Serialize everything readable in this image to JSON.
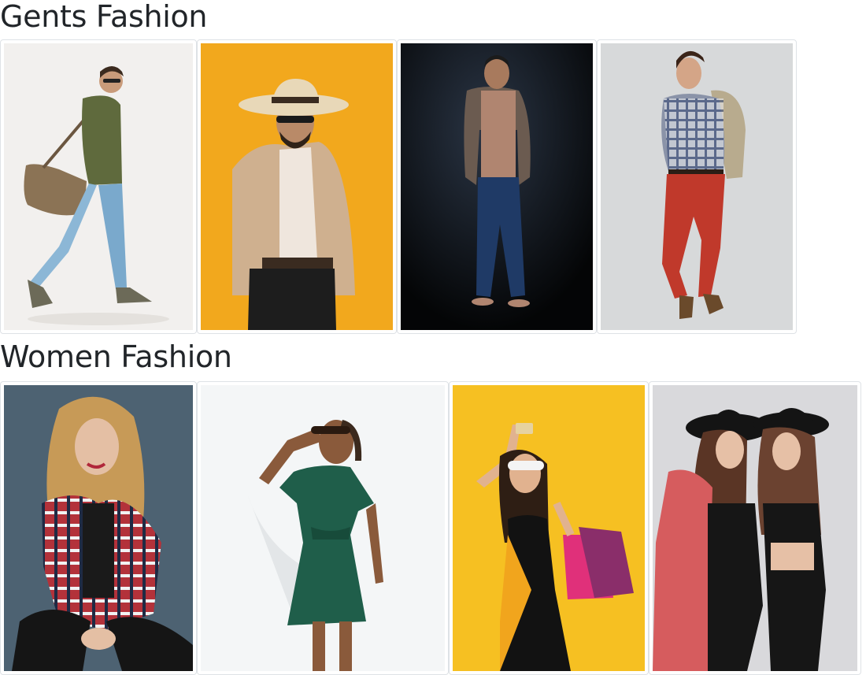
{
  "sections": [
    {
      "title": "Gents Fashion",
      "photos": [
        {
          "subject": "man-with-leather-bag",
          "background": "#f2f0ee"
        },
        {
          "subject": "man-in-hat-on-orange",
          "background": "#f2a81d"
        },
        {
          "subject": "man-in-cardigan-dark",
          "background": "#0c1015"
        },
        {
          "subject": "man-in-plaid-shirt",
          "background": "#d7d9da"
        }
      ]
    },
    {
      "title": "Women Fashion",
      "photos": [
        {
          "subject": "woman-in-plaid-shirt",
          "background": "#4d6272"
        },
        {
          "subject": "woman-in-green-dress",
          "background": "#f4f6f7"
        },
        {
          "subject": "woman-with-shopping-bags",
          "background": "#f6c022"
        },
        {
          "subject": "two-women-in-hats",
          "background": "#d9d9dc"
        }
      ]
    }
  ]
}
